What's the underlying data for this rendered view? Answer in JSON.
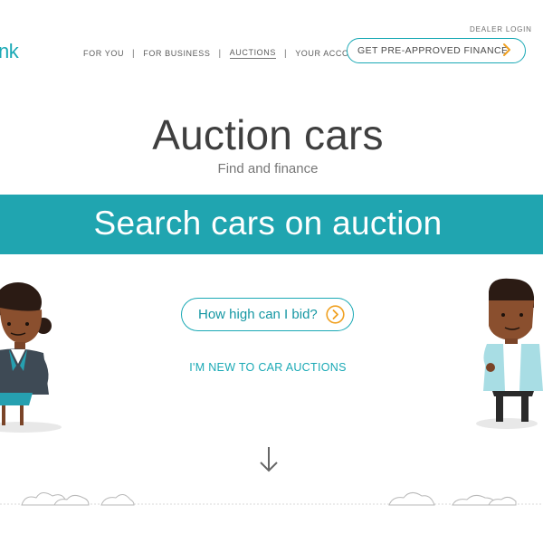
{
  "header": {
    "logo_text": "nk",
    "dealer_login": "DEALER LOGIN",
    "nav": [
      "FOR YOU",
      "FOR BUSINESS",
      "AUCTIONS",
      "YOUR ACCOUNT"
    ],
    "nav_separator": "|",
    "active_nav": "AUCTIONS",
    "finance_button": "GET PRE-APPROVED FINANCE"
  },
  "hero": {
    "title": "Auction cars",
    "subtitle": "Find and finance"
  },
  "banner": {
    "text": "Search cars on auction"
  },
  "cta": {
    "bid_button": "How high can I bid?",
    "new_link": "I'M NEW TO CAR AUCTIONS"
  },
  "icons": {
    "finance_chevron": "chevron-right-icon",
    "bid_chevron": "chevron-right-circle-icon",
    "scroll": "arrow-down-icon"
  },
  "colors": {
    "accent": "#1aa9b5",
    "banner": "#20a5b0",
    "chevron": "#f0a020"
  }
}
